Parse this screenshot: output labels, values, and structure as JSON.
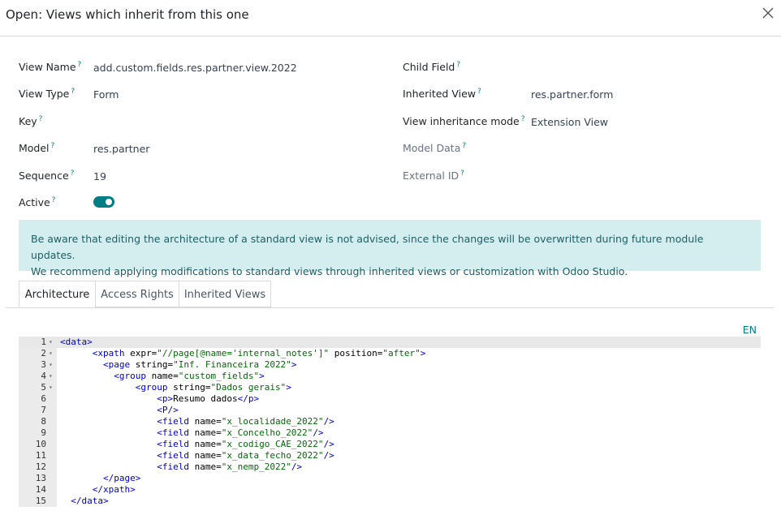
{
  "dialog": {
    "title": "Open: Views which inherit from this one"
  },
  "fields": {
    "view_name": {
      "label": "View Name",
      "value": "add.custom.fields.res.partner.view.2022"
    },
    "view_type": {
      "label": "View Type",
      "value": "Form"
    },
    "key": {
      "label": "Key",
      "value": ""
    },
    "model": {
      "label": "Model",
      "value": "res.partner"
    },
    "sequence": {
      "label": "Sequence",
      "value": "19"
    },
    "active": {
      "label": "Active",
      "value": true
    },
    "child_field": {
      "label": "Child Field",
      "value": ""
    },
    "inherited_view": {
      "label": "Inherited View",
      "value": "res.partner.form"
    },
    "inheritance_mode": {
      "label": "View inheritance mode",
      "value": "Extension View"
    },
    "model_data": {
      "label": "Model Data",
      "value": ""
    },
    "external_id": {
      "label": "External ID",
      "value": ""
    },
    "help_mark": "?"
  },
  "alert": {
    "line1": "Be aware that editing the architecture of a standard view is not advised, since the changes will be overwritten during future module updates.",
    "line2": "We recommend applying modifications to standard views through inherited views or customization with Odoo Studio."
  },
  "tabs": [
    {
      "label": "Architecture",
      "active": true
    },
    {
      "label": "Access Rights",
      "active": false
    },
    {
      "label": "Inherited Views",
      "active": false
    }
  ],
  "editor": {
    "lang": "EN",
    "lines": [
      {
        "n": "1",
        "fold": "▾",
        "text": "<data>"
      },
      {
        "n": "2",
        "fold": "▾",
        "text": "      <xpath expr=\"//page[@name='internal_notes']\" position=\"after\">"
      },
      {
        "n": "3",
        "fold": "▾",
        "text": "        <page string=\"Inf. Financeira 2022\">"
      },
      {
        "n": "4",
        "fold": "▾",
        "text": "          <group name=\"custom_fields\">"
      },
      {
        "n": "5",
        "fold": "▾",
        "text": "              <group string=\"Dados gerais\">"
      },
      {
        "n": "6",
        "fold": "",
        "text": "                  <p>Resumo dados</p>"
      },
      {
        "n": "7",
        "fold": "",
        "text": "                  <P/>"
      },
      {
        "n": "8",
        "fold": "",
        "text": "                  <field name=\"x_localidade_2022\"/>"
      },
      {
        "n": "9",
        "fold": "",
        "text": "                  <field name=\"x_Concelho_2022\"/>"
      },
      {
        "n": "10",
        "fold": "",
        "text": "                  <field name=\"x_codigo_CAE_2022\"/>"
      },
      {
        "n": "11",
        "fold": "",
        "text": "                  <field name=\"x_data_fecho_2022\"/>"
      },
      {
        "n": "12",
        "fold": "",
        "text": "                  <field name=\"x_nemp_2022\"/>"
      },
      {
        "n": "13",
        "fold": "",
        "text": "        </page>"
      },
      {
        "n": "14",
        "fold": "",
        "text": "      </xpath>"
      },
      {
        "n": "15",
        "fold": "",
        "text": "  </data>"
      }
    ]
  },
  "colors": {
    "accent": "#017e84",
    "alert_bg": "#d4edef",
    "alert_text": "#1f5f65"
  }
}
